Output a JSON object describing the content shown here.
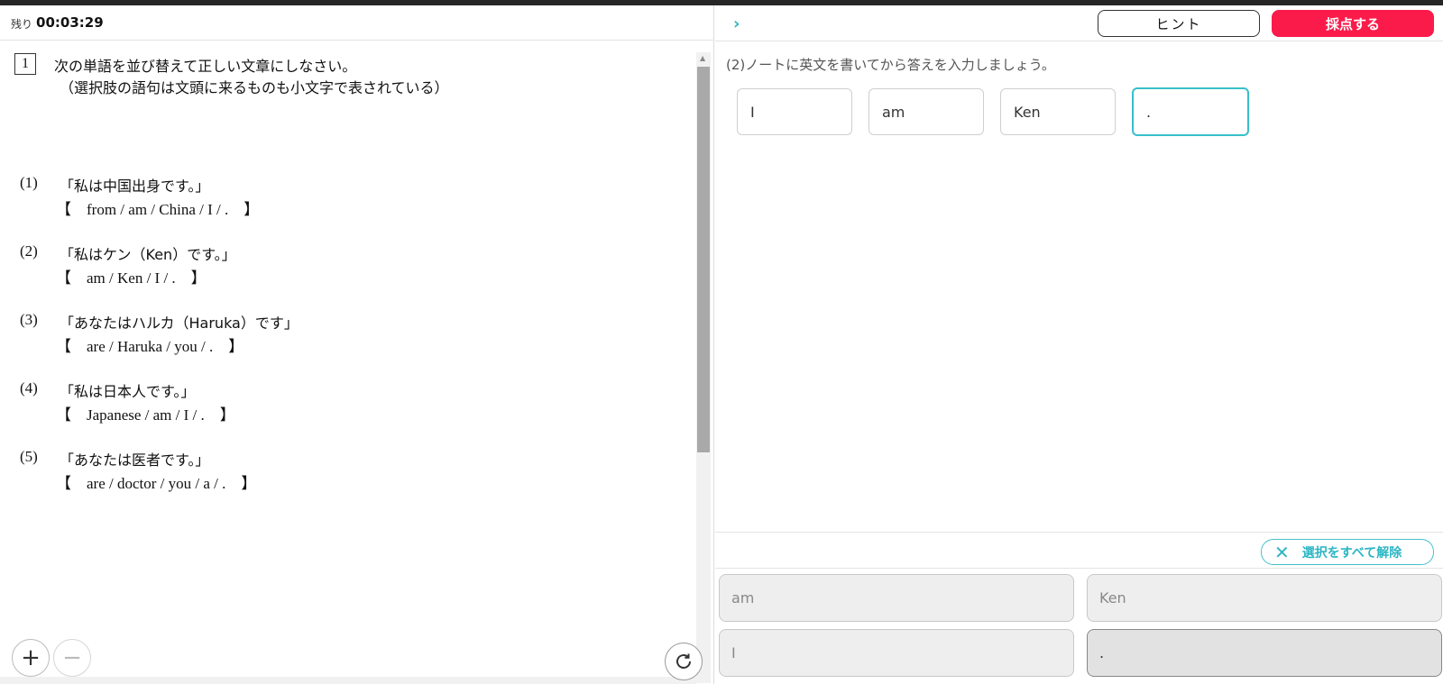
{
  "timer": {
    "label": "残り",
    "value": "00:03:29"
  },
  "document": {
    "question_number": "1",
    "instruction_line1": "次の単語を並び替えて正しい文章にしなさい。",
    "instruction_line2": "（選択肢の語句は文頭に来るものも小文字で表されている）",
    "items": [
      {
        "num": "(1)",
        "japanese": "「私は中国出身です。」",
        "choices": "【　from / am / China / I / .　】"
      },
      {
        "num": "(2)",
        "japanese": "「私はケン（Ken）です。」",
        "choices": "【　am / Ken / I / .　】"
      },
      {
        "num": "(3)",
        "japanese": "「あなたはハルカ（Haruka）です」",
        "choices": "【　are / Haruka / you / .　】"
      },
      {
        "num": "(4)",
        "japanese": "「私は日本人です。」",
        "choices": "【　Japanese / am / I / .　】"
      },
      {
        "num": "(5)",
        "japanese": "「あなたは医者です。」",
        "choices": "【　are / doctor / you / a / .　】"
      }
    ]
  },
  "controls": {
    "zoom_in": "+",
    "zoom_out": "−"
  },
  "header": {
    "hint_label": "ヒント",
    "score_label": "採点する"
  },
  "exercise": {
    "prompt": "(2)ノートに英文を書いてから答えを入力しましょう。",
    "answers": [
      "I",
      "am",
      "Ken",
      "."
    ],
    "active_answer_index": 3
  },
  "clear_all_label": "選択をすべて解除",
  "word_tiles": [
    {
      "label": "am",
      "selected": false
    },
    {
      "label": "Ken",
      "selected": false
    },
    {
      "label": "I",
      "selected": false
    },
    {
      "label": ".",
      "selected": true
    }
  ],
  "colors": {
    "accent": "#2bb6c4",
    "score_button": "#fb1b4a",
    "scroll_thumb": "#a9a9a9"
  }
}
